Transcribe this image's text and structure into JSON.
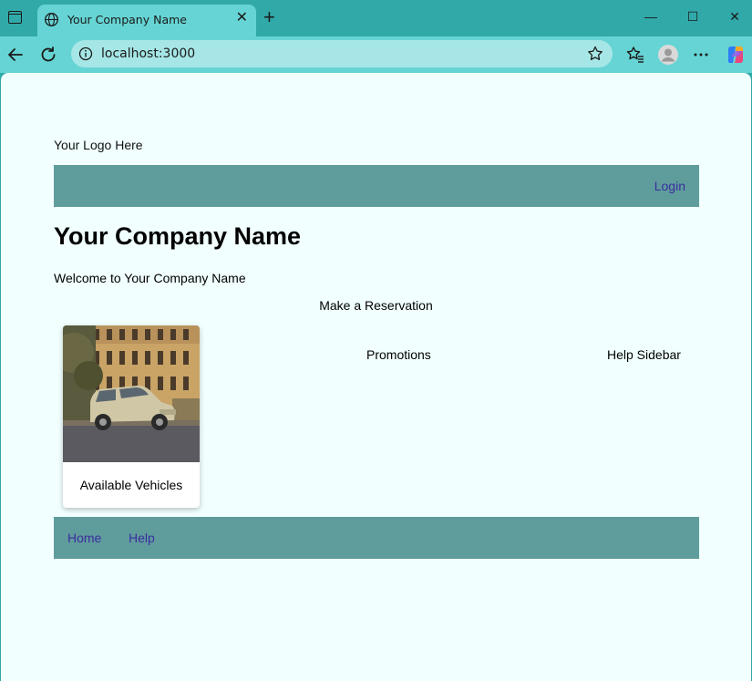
{
  "browser": {
    "tab_title": "Your Company Name",
    "url": "localhost:3000"
  },
  "page": {
    "logo_text": "Your Logo Here",
    "login_link": "Login",
    "heading": "Your Company Name",
    "welcome_text": "Welcome to Your Company Name",
    "reservation_text": "Make a Reservation",
    "card_caption": "Available Vehicles",
    "promotions_text": "Promotions",
    "help_sidebar_text": "Help Sidebar",
    "footer_links": [
      "Home",
      "Help"
    ]
  },
  "colors": {
    "chrome": "#32a9a9",
    "toolbar": "#66d4d4",
    "page_bg": "#f1ffff",
    "bar": "#5f9c9c",
    "link": "#3b2ea0"
  },
  "icons": [
    "window-icon",
    "globe-icon",
    "close-icon",
    "new-tab-icon",
    "minimize-icon",
    "maximize-icon",
    "back-icon",
    "refresh-icon",
    "info-icon",
    "star-icon",
    "favorites-icon",
    "profile-icon",
    "more-icon",
    "copilot-icon"
  ]
}
